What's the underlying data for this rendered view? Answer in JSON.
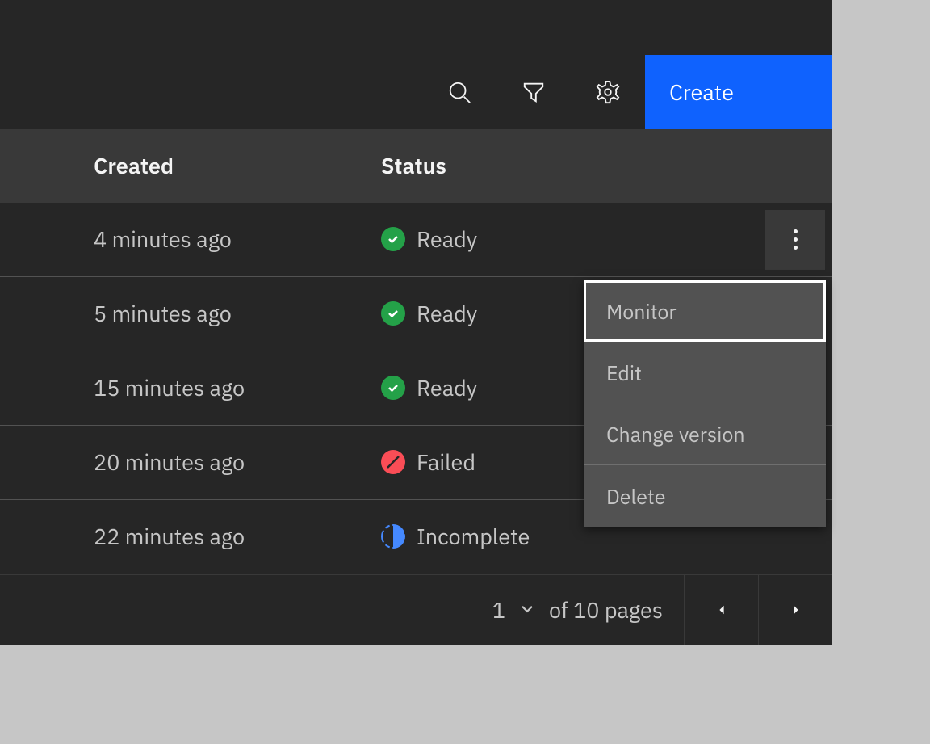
{
  "toolbar": {
    "create_label": "Create"
  },
  "columns": {
    "created": "Created",
    "status": "Status"
  },
  "rows": [
    {
      "created": "4 minutes ago",
      "status_label": "Ready",
      "status_type": "ready",
      "has_kebab": true
    },
    {
      "created": "5 minutes ago",
      "status_label": "Ready",
      "status_type": "ready",
      "has_kebab": false
    },
    {
      "created": "15 minutes ago",
      "status_label": "Ready",
      "status_type": "ready",
      "has_kebab": false
    },
    {
      "created": "20 minutes ago",
      "status_label": "Failed",
      "status_type": "failed",
      "has_kebab": false
    },
    {
      "created": "22 minutes ago",
      "status_label": "Incomplete",
      "status_type": "incomplete",
      "has_kebab": false
    }
  ],
  "context_menu": {
    "items": [
      {
        "label": "Monitor",
        "selected": true
      },
      {
        "label": "Edit",
        "selected": false
      },
      {
        "label": "Change version",
        "selected": false
      }
    ],
    "divider_after": 2,
    "footer_items": [
      {
        "label": "Delete",
        "selected": false
      }
    ]
  },
  "pagination": {
    "current_page": "1",
    "total_label": "of 10 pages"
  }
}
